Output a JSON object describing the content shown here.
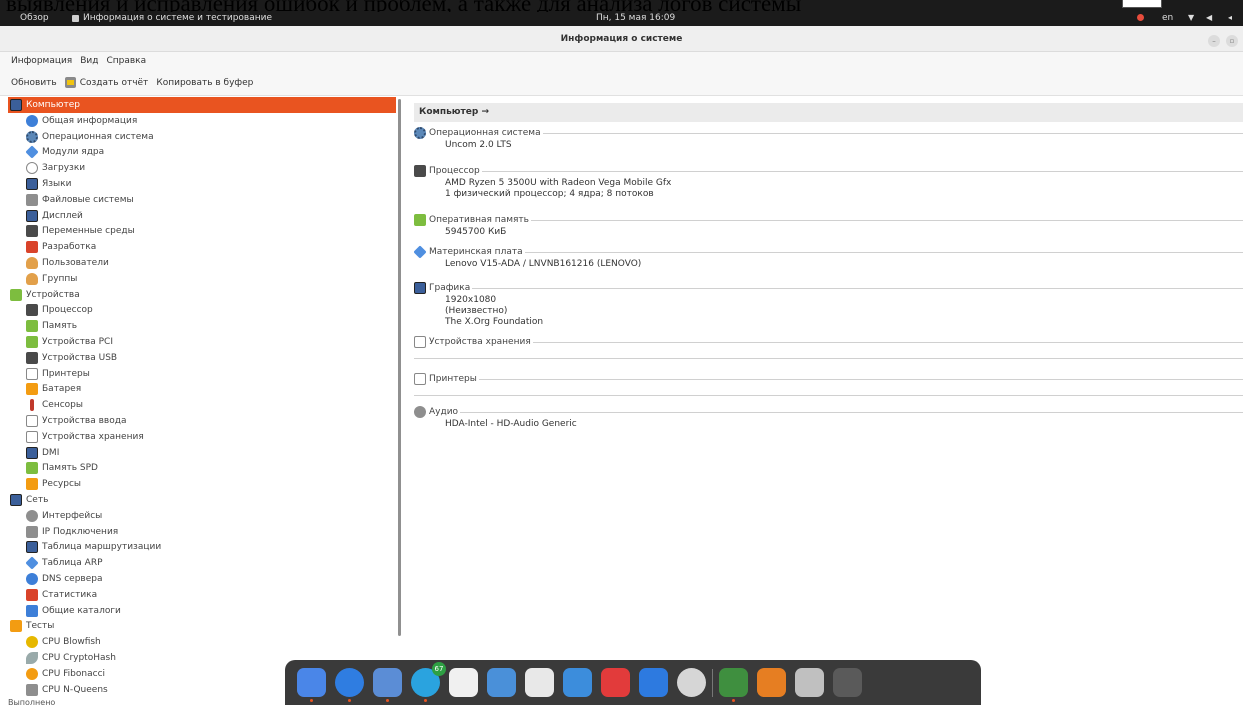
{
  "overlay": {
    "text": "выявления и исправления ошибок и проблем, а также для анализа логов системы"
  },
  "topbar": {
    "overview": "Обзор",
    "app_name": "Информация о системе и тестирование",
    "clock": "Пн, 15 мая 16:09",
    "lang": "en",
    "icons": [
      "record-icon",
      "wifi-icon",
      "volume-icon",
      "power-icon"
    ]
  },
  "window": {
    "title": "Информация о системе"
  },
  "menu": {
    "items": [
      "Информация",
      "Вид",
      "Справка"
    ]
  },
  "toolbar": {
    "refresh": "Обновить",
    "report": "Создать отчёт",
    "copy": "Копировать в буфер"
  },
  "sidebar": {
    "items": [
      {
        "label": "Компьютер",
        "level": 0,
        "icon": "computer-icon",
        "selected": true
      },
      {
        "label": "Общая информация",
        "level": 1,
        "icon": "info-icon"
      },
      {
        "label": "Операционная система",
        "level": 1,
        "icon": "os-icon"
      },
      {
        "label": "Модули ядра",
        "level": 1,
        "icon": "kernel-modules-icon"
      },
      {
        "label": "Загрузки",
        "level": 1,
        "icon": "boots-icon"
      },
      {
        "label": "Языки",
        "level": 1,
        "icon": "languages-icon"
      },
      {
        "label": "Файловые системы",
        "level": 1,
        "icon": "filesystems-icon"
      },
      {
        "label": "Дисплей",
        "level": 1,
        "icon": "display-icon"
      },
      {
        "label": "Переменные среды",
        "level": 1,
        "icon": "environment-icon"
      },
      {
        "label": "Разработка",
        "level": 1,
        "icon": "development-icon"
      },
      {
        "label": "Пользователи",
        "level": 1,
        "icon": "users-icon"
      },
      {
        "label": "Группы",
        "level": 1,
        "icon": "groups-icon"
      },
      {
        "label": "Устройства",
        "level": 0,
        "icon": "devices-icon"
      },
      {
        "label": "Процессор",
        "level": 1,
        "icon": "processor-icon"
      },
      {
        "label": "Память",
        "level": 1,
        "icon": "memory-icon"
      },
      {
        "label": "Устройства PCI",
        "level": 1,
        "icon": "pci-icon"
      },
      {
        "label": "Устройства USB",
        "level": 1,
        "icon": "usb-icon"
      },
      {
        "label": "Принтеры",
        "level": 1,
        "icon": "printer-icon"
      },
      {
        "label": "Батарея",
        "level": 1,
        "icon": "battery-icon"
      },
      {
        "label": "Сенсоры",
        "level": 1,
        "icon": "sensors-icon"
      },
      {
        "label": "Устройства ввода",
        "level": 1,
        "icon": "input-devices-icon"
      },
      {
        "label": "Устройства хранения",
        "level": 1,
        "icon": "storage-icon"
      },
      {
        "label": "DMI",
        "level": 1,
        "icon": "dmi-icon"
      },
      {
        "label": "Память SPD",
        "level": 1,
        "icon": "spd-icon"
      },
      {
        "label": "Ресурсы",
        "level": 1,
        "icon": "resources-icon"
      },
      {
        "label": "Сеть",
        "level": 0,
        "icon": "network-icon"
      },
      {
        "label": "Интерфейсы",
        "level": 1,
        "icon": "interfaces-icon"
      },
      {
        "label": "IP Подключения",
        "level": 1,
        "icon": "ip-connections-icon"
      },
      {
        "label": "Таблица маршрутизации",
        "level": 1,
        "icon": "routing-icon"
      },
      {
        "label": "Таблица ARP",
        "level": 1,
        "icon": "arp-icon"
      },
      {
        "label": "DNS сервера",
        "level": 1,
        "icon": "dns-icon"
      },
      {
        "label": "Статистика",
        "level": 1,
        "icon": "statistics-icon"
      },
      {
        "label": "Общие каталоги",
        "level": 1,
        "icon": "shared-dirs-icon"
      },
      {
        "label": "Тесты",
        "level": 0,
        "icon": "benchmarks-icon"
      },
      {
        "label": "CPU Blowfish",
        "level": 1,
        "icon": "blowfish-icon"
      },
      {
        "label": "CPU CryptoHash",
        "level": 1,
        "icon": "cryptohash-icon"
      },
      {
        "label": "CPU Fibonacci",
        "level": 1,
        "icon": "fibonacci-icon"
      },
      {
        "label": "CPU N-Queens",
        "level": 1,
        "icon": "nqueens-icon"
      }
    ]
  },
  "content": {
    "breadcrumb": "Компьютер →",
    "sections": [
      {
        "title": "Операционная система",
        "icon": "os-icon",
        "values": [
          "Uncom 2.0 LTS"
        ]
      },
      {
        "title": "Процессор",
        "icon": "processor-icon",
        "values": [
          "AMD Ryzen 5 3500U with Radeon Vega Mobile Gfx",
          "1 физический процессор; 4 ядра; 8 потоков"
        ]
      },
      {
        "title": "Оперативная память",
        "icon": "memory-icon",
        "values": [
          "5945700 КиБ"
        ]
      },
      {
        "title": "Материнская плата",
        "icon": "motherboard-icon",
        "values": [
          "Lenovo V15-ADA / LNVNB161216 (LENOVO)"
        ]
      },
      {
        "title": "Графика",
        "icon": "display-icon",
        "values": [
          "1920x1080",
          "(Неизвестно)",
          "The X.Org Foundation"
        ]
      },
      {
        "title": "Устройства хранения",
        "icon": "storage-icon",
        "values": []
      },
      {
        "title": "Принтеры",
        "icon": "printer-icon",
        "values": []
      },
      {
        "title": "Аудио",
        "icon": "audio-icon",
        "values": [
          "HDA-Intel - HD-Audio Generic"
        ]
      }
    ]
  },
  "dock": {
    "apps": [
      {
        "name": "files-icon",
        "color": "#4a86e8"
      },
      {
        "name": "chromium-icon",
        "color": "#2f7de1"
      },
      {
        "name": "mail-icon",
        "color": "#5b8dd6"
      },
      {
        "name": "telegram-icon",
        "color": "#2aa3df",
        "badge": "67"
      },
      {
        "name": "photos-icon",
        "color": "#f0f0f0"
      },
      {
        "name": "settings-list-icon",
        "color": "#4a90d9"
      },
      {
        "name": "calendar-icon",
        "color": "#e8e8e8"
      },
      {
        "name": "image-viewer-icon",
        "color": "#3c8ddc"
      },
      {
        "name": "music-icon",
        "color": "#e23b3b"
      },
      {
        "name": "software-center-icon",
        "color": "#2d7ae0"
      },
      {
        "name": "system-settings-icon",
        "color": "#d6d6d6"
      },
      {
        "name": "hardinfo-icon",
        "color": "#3f8f3f",
        "active": true
      },
      {
        "name": "app-diamond-icon",
        "color": "#e67e22"
      },
      {
        "name": "trash-icon",
        "color": "#c0c0c0"
      },
      {
        "name": "app-grid-icon",
        "color": "#5a5a5a"
      }
    ]
  },
  "status": {
    "text": "Выполнено"
  }
}
